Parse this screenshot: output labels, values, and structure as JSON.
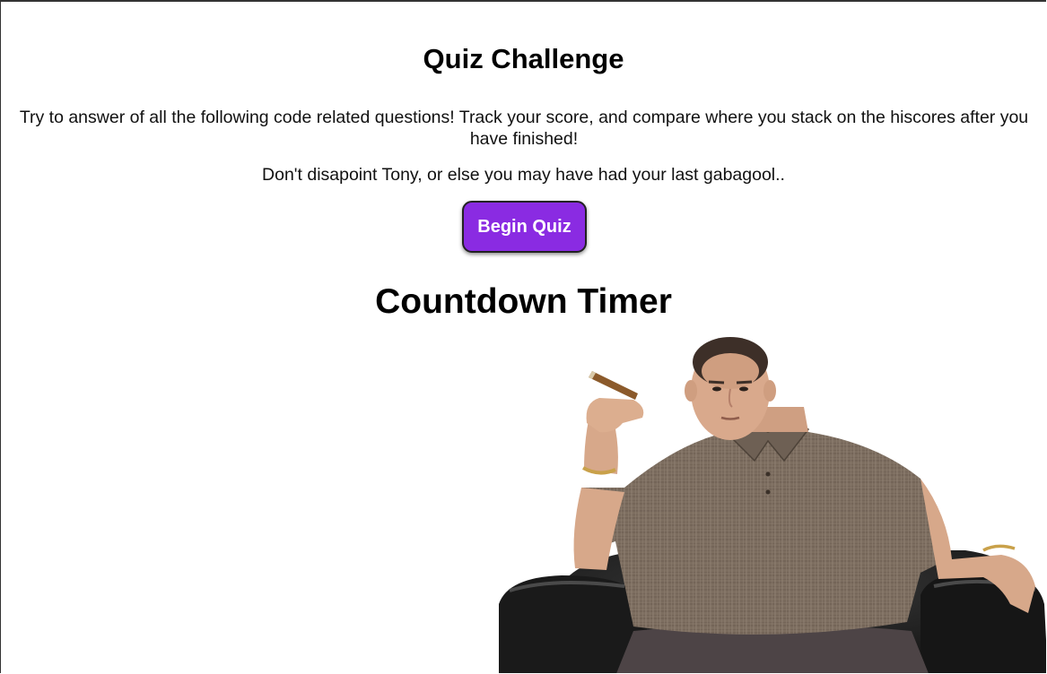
{
  "header": {
    "title": "Quiz Challenge"
  },
  "intro": {
    "text": "Try to answer of all the following code related questions! Track your score, and compare where you stack on the hiscores after you have finished!",
    "warning": "Don't disapoint Tony, or else you may have had your last gabagool.."
  },
  "actions": {
    "begin_label": "Begin Quiz"
  },
  "timer": {
    "label": "Countdown Timer"
  },
  "colors": {
    "button": "#8a2be2",
    "button_text": "#ffffff"
  },
  "images": {
    "character": "man-in-armchair-with-cigar"
  }
}
